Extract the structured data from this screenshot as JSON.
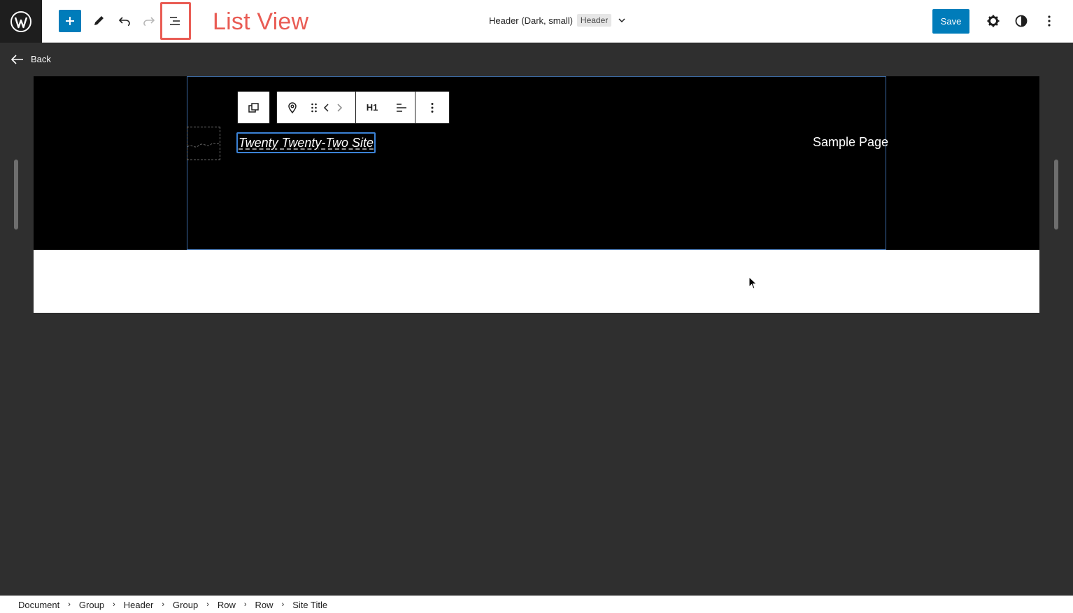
{
  "topbar": {
    "wordpress_logo_icon": "wordpress-icon",
    "add_block_icon": "plus-icon",
    "tools_icon": "pencil-icon",
    "undo_icon": "undo-icon",
    "redo_icon": "redo-icon",
    "list_view_icon": "list-view-icon",
    "annotation": "List View",
    "document_title": "Header (Dark, small)",
    "document_badge": "Header",
    "save_label": "Save",
    "settings_icon": "gear-icon",
    "styles_icon": "half-circle-icon",
    "options_icon": "vertical-dots-icon"
  },
  "back": {
    "label": "Back"
  },
  "canvas": {
    "site_title": "Twenty Twenty-Two Site",
    "nav_link": "Sample Page",
    "block_toolbar": {
      "heading_level": "H1"
    }
  },
  "breadcrumb": [
    "Document",
    "Group",
    "Header",
    "Group",
    "Row",
    "Row",
    "Site Title"
  ],
  "colors": {
    "accent": "#007cba",
    "annotation": "#e95c54",
    "editor_background": "#2f2f2f",
    "selection_outline": "#3b82d6"
  }
}
